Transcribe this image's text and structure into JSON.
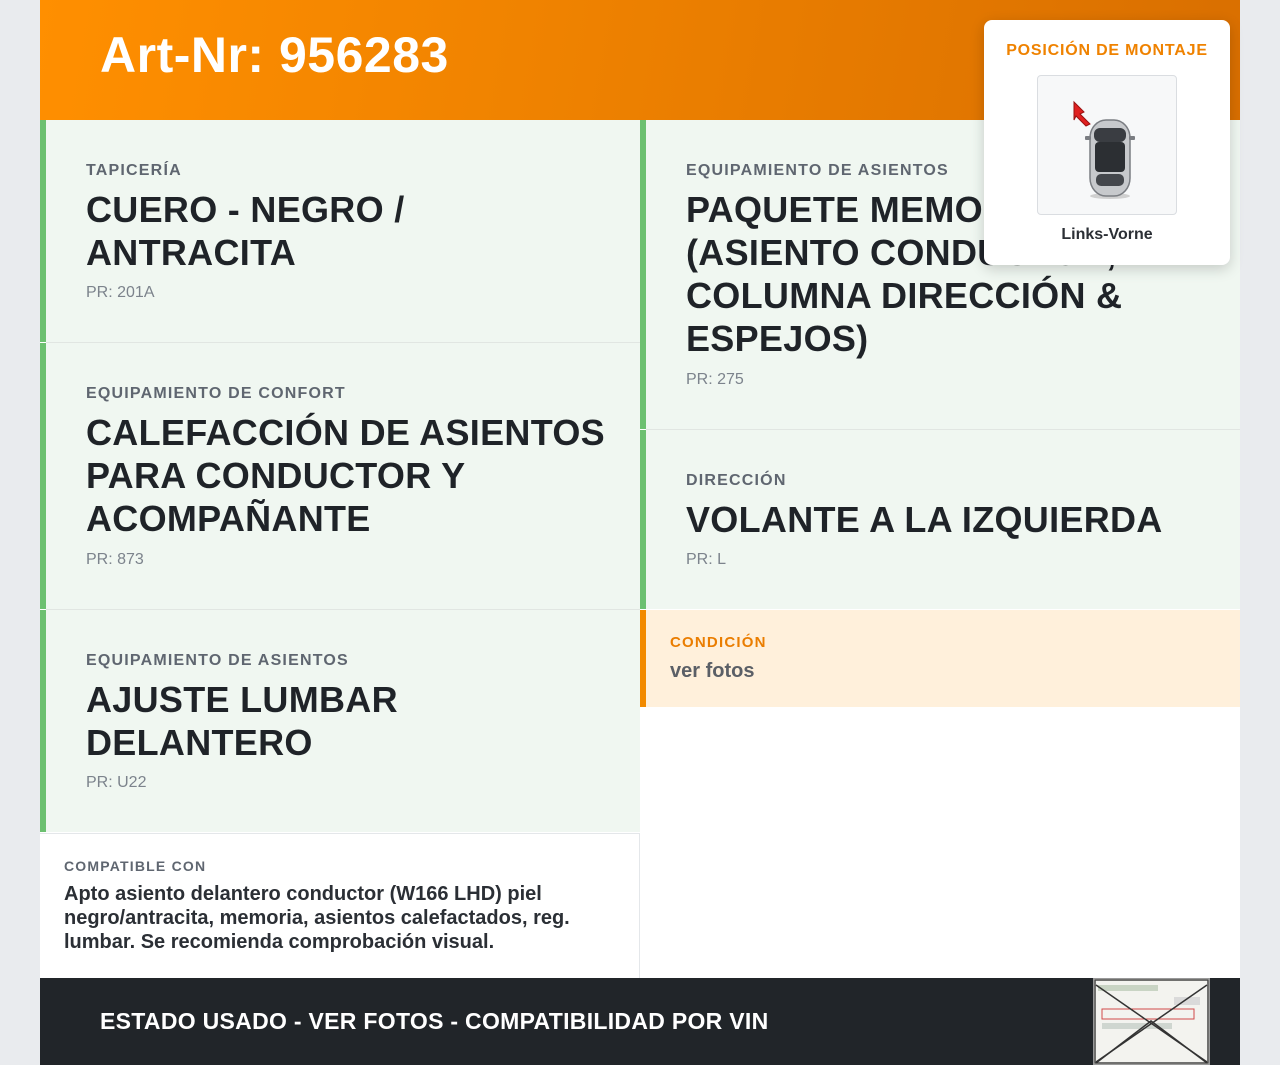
{
  "header": {
    "art_nr": "Art-Nr: 956283"
  },
  "features": [
    {
      "label": "Tapicería",
      "value": "Cuero - negro / antracita",
      "pr": "PR: 201A"
    },
    {
      "label": "Equipamiento de confort",
      "value": "Calefacción de asientos para conductor y acompañante",
      "pr": "PR: 873"
    },
    {
      "label": "Equipamiento de asientos",
      "value": "Ajuste lumbar delantero",
      "pr": "PR: U22"
    },
    {
      "label": "Equipamiento de asientos",
      "value": "Paquete memoria (asiento conductor, columna dirección & espejos)",
      "pr": "PR: 275"
    },
    {
      "label": "Dirección",
      "value": "Volante a la izquierda",
      "pr": "PR: L"
    }
  ],
  "condition": {
    "label": "CONDICIÓN",
    "value": "ver fotos"
  },
  "compatible": {
    "label": "COMPATIBLE CON",
    "text": "Apto asiento delantero conductor (W166 LHD) piel negro/antracita, memoria, asientos calefactados, reg. lumbar. Se recomienda comprobación visual."
  },
  "footer": {
    "text": "ESTADO USADO - VER FOTOS - COMPATIBILIDAD POR VIN"
  },
  "popup": {
    "title": "POSICIÓN DE MONTAJE",
    "position": "Links-Vorne"
  },
  "colors": {
    "accent": "#f28a00",
    "feature_border": "#6cc070",
    "feature_bg": "#f0f7f1",
    "footer_bg": "#212529"
  }
}
